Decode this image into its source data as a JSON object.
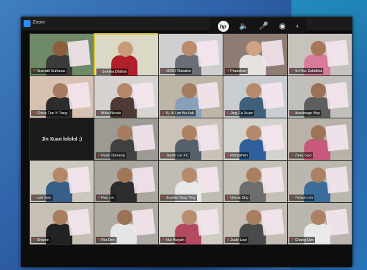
{
  "window": {
    "title": "Zoom"
  },
  "toolbar": {
    "brand": "hp",
    "icons": [
      "speaker-icon",
      "microphone-icon",
      "broadcast-icon",
      "chevron-left-icon"
    ]
  },
  "participants": [
    {
      "name": "Nusratli Suthana",
      "bg": "#6f8a66",
      "skin": "#8d5f3f",
      "shirt": "#3b3b3b",
      "paper": true
    },
    {
      "name": "Seetha Dhillon",
      "bg": "#dcd8c6",
      "skin": "#c99a79",
      "shirt": "#b21f2a",
      "paper": false,
      "active": true
    },
    {
      "name": "JOSH Rosales",
      "bg": "#cfcfd2",
      "skin": "#b98a6b",
      "shirt": "#6a6e77",
      "paper": true
    },
    {
      "name": "Prasshan",
      "bg": "#8f7c74",
      "skin": "#d1a283",
      "shirt": "#e6e3df",
      "paper": true
    },
    {
      "name": "Sri Nur Zulaikha",
      "bg": "#c7c2bc",
      "skin": "#a8775a",
      "shirt": "#d87a9a",
      "paper": true
    },
    {
      "name": "Chloe Tan Yi Tong",
      "bg": "#d7c1b1",
      "skin": "#a67a5e",
      "shirt": "#2c2c2c",
      "paper": true
    },
    {
      "name": "Mika Nicole",
      "bg": "#d6d3d0",
      "skin": "#b48769",
      "shirt": "#4e3a35",
      "paper": true
    },
    {
      "name": "Kj Hi Lim Ba Lok",
      "bg": "#bdb5a6",
      "skin": "#a27b61",
      "shirt": "#8aa0b8",
      "paper": true
    },
    {
      "name": "Jing Fa Xuan",
      "bg": "#c9ccd0",
      "skin": "#b68a6c",
      "shirt": "#3f5f7a",
      "paper": true
    },
    {
      "name": "Abednego Boy",
      "bg": "#c1bfba",
      "skin": "#9a7156",
      "shirt": "#5d5d5d",
      "paper": true
    },
    {
      "name": "Jin Xuan lololol :)",
      "text_only": true
    },
    {
      "name": "Ryan Dunang",
      "bg": "#9c9a92",
      "skin": "#a67b5f",
      "shirt": "#404040",
      "paper": true
    },
    {
      "name": "Jaydn Lui XC",
      "bg": "#c9c2b8",
      "skin": "#ad8263",
      "shirt": "#56606d",
      "paper": true
    },
    {
      "name": "Rongshen",
      "bg": "#d4d2cc",
      "skin": "#b38a6b",
      "shirt": "#2f5f9a",
      "paper": true
    },
    {
      "name": "Zoey Gao",
      "bg": "#b8b2a9",
      "skin": "#9e7458",
      "shirt": "#c75a7a",
      "paper": true
    },
    {
      "name": "Lee Sun",
      "bg": "#cdc8bd",
      "skin": "#b58868",
      "shirt": "#385f88",
      "paper": true
    },
    {
      "name": "Ray Lin",
      "bg": "#aba79e",
      "skin": "#a07858",
      "shirt": "#2d2d2d",
      "paper": true
    },
    {
      "name": "Sophia Tang Ying",
      "bg": "#bfbcb4",
      "skin": "#b48a6a",
      "shirt": "#e8e8e8",
      "paper": true
    },
    {
      "name": "Qiana Sng",
      "bg": "#c5c1b9",
      "skin": "#a97f62",
      "shirt": "#6d6d6d",
      "paper": true
    },
    {
      "name": "Yuhan Lim",
      "bg": "#bcb7ae",
      "skin": "#ac8164",
      "shirt": "#3b6d9a",
      "paper": true
    },
    {
      "name": "Sharon",
      "bg": "#c6bfb4",
      "skin": "#a97d60",
      "shirt": "#222222",
      "paper": true
    },
    {
      "name": "Nia Dev",
      "bg": "#b0aba2",
      "skin": "#9b7257",
      "shirt": "#e5e5e5",
      "paper": true
    },
    {
      "name": "Nur Aisyah",
      "bg": "#d0ccc4",
      "skin": "#b88d6d",
      "shirt": "#b44a60",
      "paper": true
    },
    {
      "name": "Jude Low",
      "bg": "#c3bdb4",
      "skin": "#a87e61",
      "shirt": "#4a4a4a",
      "paper": true
    },
    {
      "name": "Chang Lim",
      "bg": "#bab6ad",
      "skin": "#ad8264",
      "shirt": "#e9e9e9",
      "paper": true
    }
  ]
}
